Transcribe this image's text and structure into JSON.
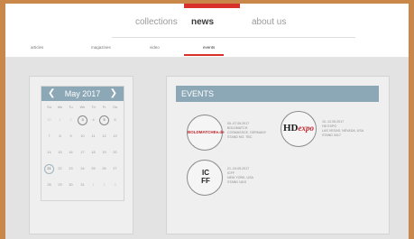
{
  "nav": {
    "items": [
      "collections",
      "news",
      "about us"
    ],
    "active": "news"
  },
  "subnav": {
    "items": [
      "articles",
      "magazines",
      "video",
      "events"
    ],
    "active": "events"
  },
  "calendar": {
    "prev": "❮",
    "next": "❯",
    "title": "May 2017",
    "weekdays": [
      "Su",
      "Mo",
      "Tu",
      "We",
      "Th",
      "Fr",
      "Sa"
    ],
    "weeks": [
      [
        "30",
        "1",
        "2",
        "3",
        "4",
        "5",
        "6"
      ],
      [
        "7",
        "8",
        "9",
        "10",
        "11",
        "12",
        "13"
      ],
      [
        "14",
        "15",
        "16",
        "17",
        "18",
        "19",
        "20"
      ],
      [
        "21",
        "22",
        "23",
        "24",
        "25",
        "26",
        "27"
      ],
      [
        "28",
        "29",
        "30",
        "31",
        "1",
        "2",
        "3"
      ]
    ]
  },
  "events": {
    "title": "EVENTS",
    "items": [
      {
        "logo": "BOLDMATCHEe.de",
        "lines": [
          "05.-07.05.2017",
          "BOLDMATCH",
          "COSMASSCE, GERMANY",
          "STAND NO. TBC"
        ]
      },
      {
        "logo_main": "HD",
        "logo_sub": "expo",
        "lines": [
          "10.-12.05.2017",
          "HD EXPO",
          "LAS VEGAS, NEVADA, USA",
          "STAND 3417"
        ]
      },
      {
        "logo_main": "IC FF",
        "lines": [
          "21.-24.05.2017",
          "ICFF",
          "NEW YORK, USA",
          "STAND 1815"
        ]
      }
    ]
  },
  "colors": {
    "accent": "#d8302b",
    "header_blue": "#8ca8b6",
    "page_bg": "#e3e3e3"
  }
}
